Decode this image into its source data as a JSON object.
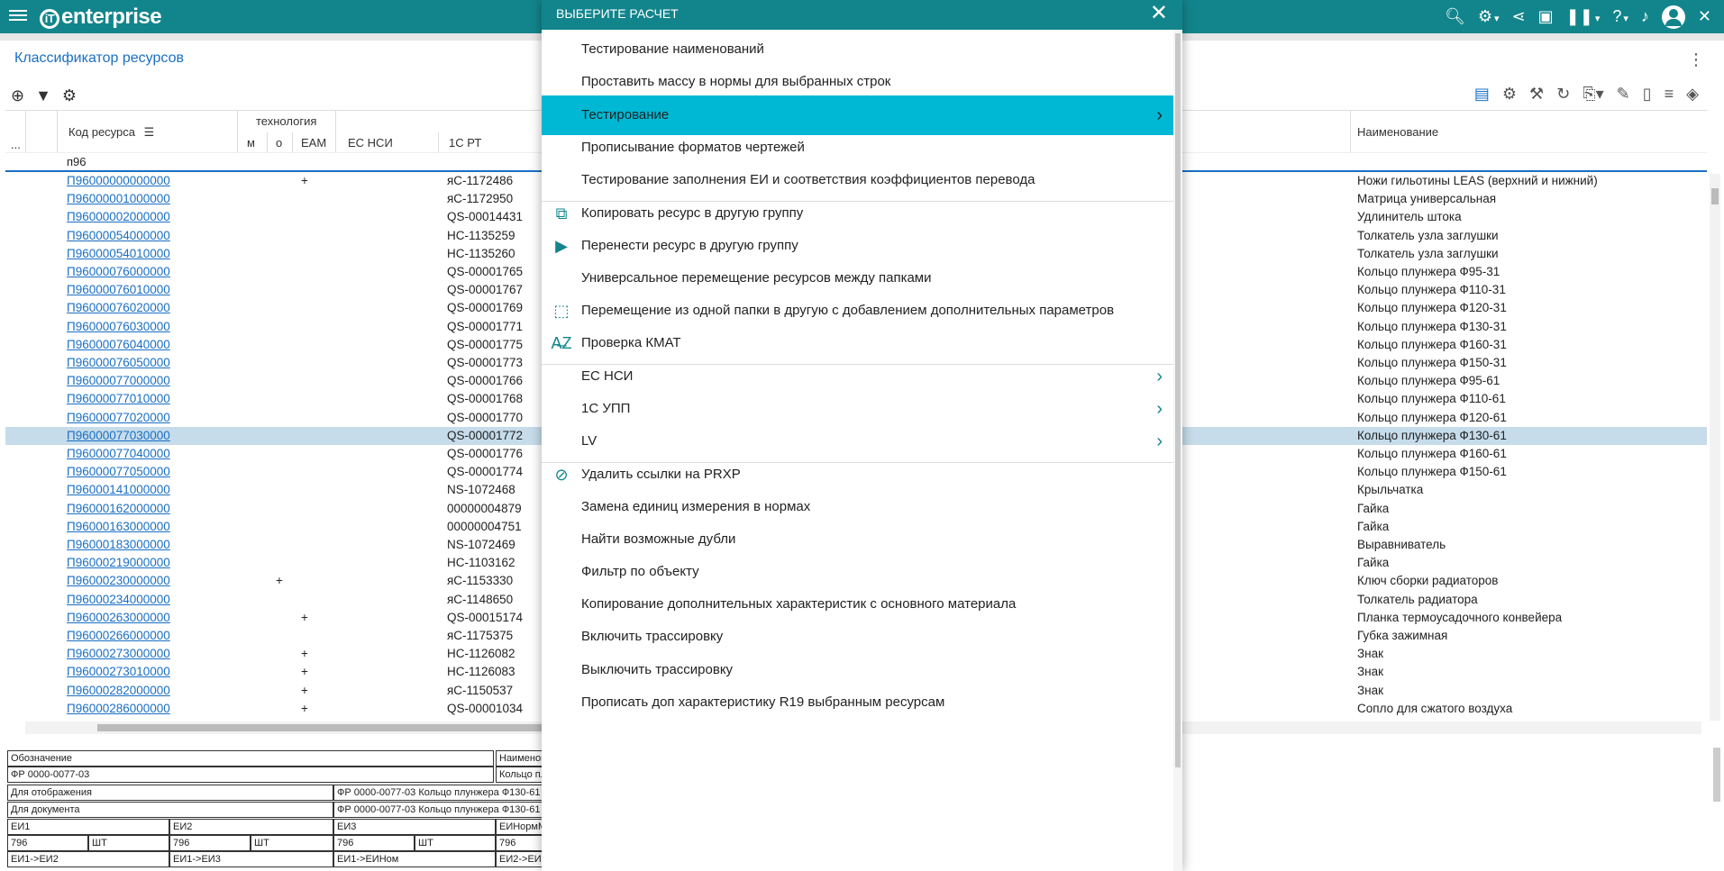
{
  "app": {
    "logo_text": "enterprise",
    "logo_glyph": "iT",
    "accent": "#12858c"
  },
  "panel": {
    "title": "Классификатор ресурсов"
  },
  "table": {
    "headers": {
      "code": "Код ресурса",
      "tech_group": "технология",
      "m": "м",
      "o": "о",
      "eam": "ЕАМ",
      "ec_nsi": "ЕС НСИ",
      "c1_rt": "1С РТ",
      "name": "Наименование",
      "dots": "..."
    },
    "filter_value": "п96",
    "rows": [
      {
        "code": "П96000000000000",
        "o": "",
        "eam": "+",
        "c1": "яС-1172486",
        "name": "Ножи гильотины LEAS (верхний и нижний)"
      },
      {
        "code": "П96000001000000",
        "o": "",
        "eam": "",
        "c1": "яС-1172950",
        "name": "Матрица универсальная"
      },
      {
        "code": "П96000002000000",
        "o": "",
        "eam": "",
        "c1": "QS-00014431",
        "name": "Удлинитель штока"
      },
      {
        "code": "П96000054000000",
        "o": "",
        "eam": "",
        "c1": "НС-1135259",
        "name": "Толкатель узла заглушки"
      },
      {
        "code": "П96000054010000",
        "o": "",
        "eam": "",
        "c1": "НС-1135260",
        "name": "Толкатель узла заглушки"
      },
      {
        "code": "П96000076000000",
        "o": "",
        "eam": "",
        "c1": "QS-00001765",
        "name": "Кольцо плунжера Ф95-31"
      },
      {
        "code": "П96000076010000",
        "o": "",
        "eam": "",
        "c1": "QS-00001767",
        "name": "Кольцо плунжера Ф110-31"
      },
      {
        "code": "П96000076020000",
        "o": "",
        "eam": "",
        "c1": "QS-00001769",
        "name": "Кольцо плунжера Ф120-31"
      },
      {
        "code": "П96000076030000",
        "o": "",
        "eam": "",
        "c1": "QS-00001771",
        "name": "Кольцо плунжера Ф130-31"
      },
      {
        "code": "П96000076040000",
        "o": "",
        "eam": "",
        "c1": "QS-00001775",
        "name": "Кольцо плунжера Ф160-31"
      },
      {
        "code": "П96000076050000",
        "o": "",
        "eam": "",
        "c1": "QS-00001773",
        "name": "Кольцо плунжера Ф150-31"
      },
      {
        "code": "П96000077000000",
        "o": "",
        "eam": "",
        "c1": "QS-00001766",
        "name": "Кольцо плунжера Ф95-61"
      },
      {
        "code": "П96000077010000",
        "o": "",
        "eam": "",
        "c1": "QS-00001768",
        "name": "Кольцо плунжера Ф110-61"
      },
      {
        "code": "П96000077020000",
        "o": "",
        "eam": "",
        "c1": "QS-00001770",
        "name": "Кольцо плунжера Ф120-61"
      },
      {
        "code": "П96000077030000",
        "o": "",
        "eam": "",
        "c1": "QS-00001772",
        "name": "Кольцо плунжера Ф130-61",
        "selected": true
      },
      {
        "code": "П96000077040000",
        "o": "",
        "eam": "",
        "c1": "QS-00001776",
        "name": "Кольцо плунжера Ф160-61"
      },
      {
        "code": "П96000077050000",
        "o": "",
        "eam": "",
        "c1": "QS-00001774",
        "name": "Кольцо плунжера Ф150-61"
      },
      {
        "code": "П96000141000000",
        "o": "",
        "eam": "",
        "c1": "NS-1072468",
        "name": "Крыльчатка"
      },
      {
        "code": "П96000162000000",
        "o": "",
        "eam": "",
        "c1": "00000004879",
        "name": "Гайка"
      },
      {
        "code": "П96000163000000",
        "o": "",
        "eam": "",
        "c1": "00000004751",
        "name": "Гайка"
      },
      {
        "code": "П96000183000000",
        "o": "",
        "eam": "",
        "c1": "NS-1072469",
        "name": "Выравниватель"
      },
      {
        "code": "П96000219000000",
        "o": "",
        "eam": "",
        "c1": "НС-1103162",
        "name": "Гайка"
      },
      {
        "code": "П96000230000000",
        "o": "+",
        "eam": "",
        "c1": "яС-1153330",
        "name": "Ключ сборки радиаторов"
      },
      {
        "code": "П96000234000000",
        "o": "",
        "eam": "",
        "c1": "яС-1148650",
        "name": "Толкатель радиатора"
      },
      {
        "code": "П96000263000000",
        "o": "",
        "eam": "+",
        "c1": "QS-00015174",
        "name": "Планка термоусадочного  конвейера"
      },
      {
        "code": "П96000266000000",
        "o": "",
        "eam": "",
        "c1": "яС-1175375",
        "name": "Губка зажимная"
      },
      {
        "code": "П96000273000000",
        "o": "",
        "eam": "+",
        "c1": "НС-1126082",
        "name": "Знак"
      },
      {
        "code": "П96000273010000",
        "o": "",
        "eam": "+",
        "c1": "НС-1126083",
        "name": "Знак"
      },
      {
        "code": "П96000282000000",
        "o": "",
        "eam": "+",
        "c1": "яС-1150537",
        "name": "Знак"
      },
      {
        "code": "П96000286000000",
        "o": "",
        "eam": "+",
        "c1": "QS-00001034",
        "name": "Сопло для сжатого воздуха"
      }
    ]
  },
  "details": {
    "oboznachenie_label": "Обозначение",
    "oboznachenie_value": "ФР 0000-0077-03",
    "naimen_label": "Наименов",
    "naimen_value": "Кольцо пл",
    "display_label": "Для отображения",
    "display_value": "ФР 0000-0077-03 Кольцо плунжера Ф130-61",
    "doc_label": "Для документа",
    "doc_value": "ФР 0000-0077-03 Кольцо плунжера Ф130-61",
    "ei1": "ЕИ1",
    "ei2": "ЕИ2",
    "ei3": "ЕИ3",
    "ei_norm": "ЕИНормМ",
    "ei1_code": "796",
    "ei1_unit": "ШТ",
    "ei2_code": "796",
    "ei2_unit": "ШТ",
    "ei3_code": "796",
    "ei3_unit": "ШТ",
    "ein_code": "796",
    "conv1": "ЕИ1->ЕИ2",
    "conv2": "ЕИ1->ЕИ3",
    "conv3": "ЕИ1->ЕИНом",
    "conv4": "ЕИ2->ЕИ"
  },
  "modal": {
    "title": "ВЫБЕРИТЕ РАСЧЕТ",
    "items": [
      {
        "label": "Тестирование наименований"
      },
      {
        "label": "Проставить массу в нормы для выбранных строк"
      },
      {
        "label": "Тестирование"
      },
      {
        "label": "Прописывание форматов чертежей"
      },
      {
        "label": "Тестирование заполнения ЕИ и соответствия коэффициентов перевода"
      },
      {
        "label": "Копировать ресурс в другую группу",
        "icon": "copy-icon"
      },
      {
        "label": "Перенести ресурс в другую группу",
        "icon": "folder-move-icon"
      },
      {
        "label": "Универсальное перемещение ресурсов между папками"
      },
      {
        "label": "Перемещение из одной папки в другую с добавлением дополнительных параметров",
        "icon": "select-area-icon"
      },
      {
        "label": "Проверка КМАТ",
        "icon": "sort-az-icon"
      },
      {
        "label": "ЕС НСИ"
      },
      {
        "label": "1С УПП"
      },
      {
        "label": "LV"
      },
      {
        "label": "Удалить ссылки на PRXP",
        "icon": "block-icon"
      },
      {
        "label": "Замена единиц измерения в нормах"
      },
      {
        "label": "Найти возможные дубли"
      },
      {
        "label": "Фильтр по объекту"
      },
      {
        "label": "Копирование дополнительных характеристик с основного материала"
      },
      {
        "label": "Включить трассировку"
      },
      {
        "label": "Выключить трассировку"
      },
      {
        "label": "Прописать доп характеристику R19 выбранным ресурсам"
      }
    ]
  }
}
